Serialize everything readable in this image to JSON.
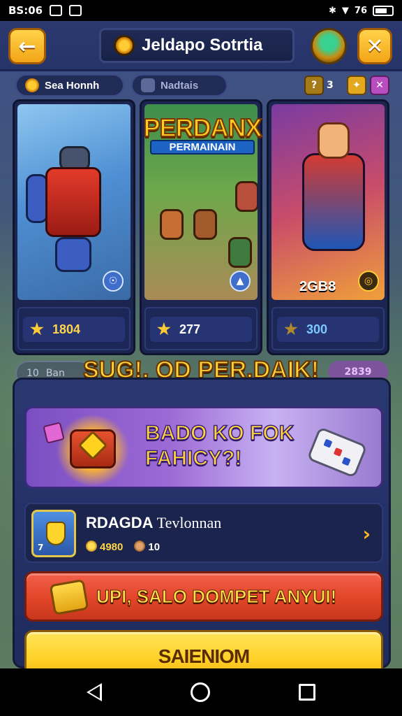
{
  "status_bar": {
    "time": "BS:06",
    "right_text": "76"
  },
  "header": {
    "title": "Jeldapo Sotrtia",
    "back_label": "←",
    "close_label": "✕"
  },
  "sub_bar": {
    "pill_a": "Sea Honnh",
    "pill_b": "Nadtais",
    "badge_count": "3"
  },
  "cards": [
    {
      "name": "robot",
      "value": "1804",
      "badge": "☉"
    },
    {
      "name": "party",
      "value": "277",
      "badge": "▲"
    },
    {
      "name": "hero",
      "value": "300",
      "tag": "2GB8",
      "badge": "◎"
    }
  ],
  "logo": {
    "main": "PERDANX",
    "sub": "PERMAINAIN"
  },
  "headline": {
    "text": "SUG!. OD PER.DAIK!",
    "left_pill": "Ban",
    "left_pill_icon": "10",
    "right_pill": "2839"
  },
  "promo": {
    "text_line1": "BADO KO FOK",
    "text_line2": "FAHICY?!"
  },
  "item": {
    "title_bold": "RDAGDA",
    "title_rest": "Tevlonnan",
    "level": "7",
    "stat_1": "4980",
    "stat_2": "10"
  },
  "buttons": {
    "orange": "UPI, SALO DOMPET ANYUI!",
    "yellow": "SAIENIOM"
  },
  "colors": {
    "accent_yellow": "#ffd53a",
    "button_orange": "#e24529",
    "panel_navy": "#2a3872"
  }
}
